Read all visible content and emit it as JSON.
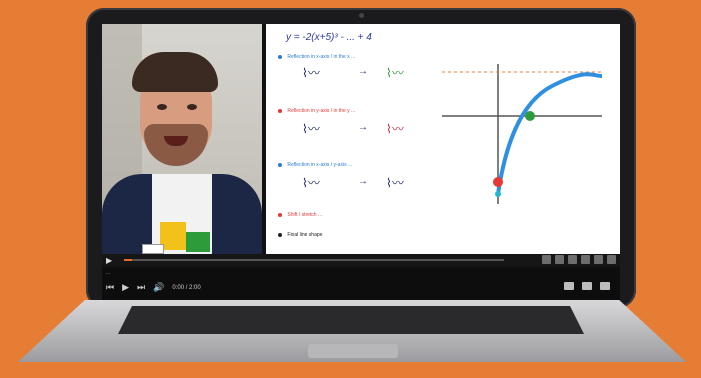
{
  "slide": {
    "equation": "y = -2(x+5)³ - ... + 4",
    "items": [
      {
        "text": "Reflection in x-axis / in the x ...",
        "color": "#2e7bd6"
      },
      {
        "text": "Reflection in y-axis / in the y ...",
        "color": "#e53935"
      },
      {
        "text": "Reflection in x-axis / y-axis ...",
        "color": "#2e7bd6"
      },
      {
        "text": "Shift / stretch ...",
        "color": "#e53935"
      },
      {
        "text": "Final line shape",
        "color": "#222222"
      }
    ]
  },
  "player": {
    "title": "...",
    "time": "0:00 / 2:00",
    "progress": 0.02
  },
  "icons": {
    "play": "▶",
    "prev": "⏮",
    "next": "⏭",
    "volume": "🔊"
  }
}
